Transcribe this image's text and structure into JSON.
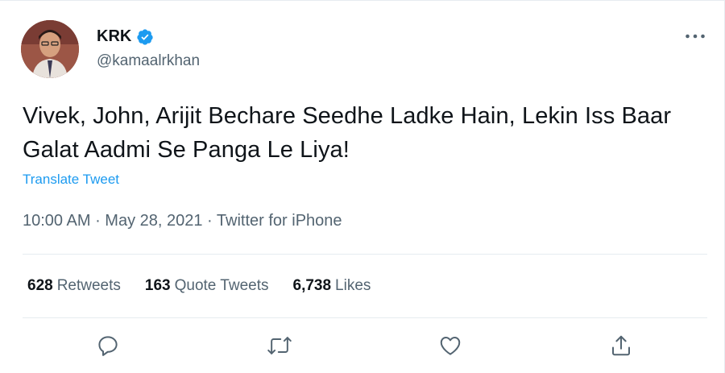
{
  "author": {
    "display_name": "KRK",
    "handle": "@kamaalrkhan",
    "verified": true,
    "avatar_icon": "profile-photo"
  },
  "tweet": {
    "text": "Vivek, John, Arijit Bechare Seedhe Ladke Hain, Lekin Iss Baar Galat Aadmi Se Panga Le Liya!",
    "translate_label": "Translate Tweet",
    "time": "10:00 AM",
    "separator": " · ",
    "date": "May 28, 2021",
    "source": "Twitter for iPhone"
  },
  "stats": {
    "retweets_count": "628",
    "retweets_label": "Retweets",
    "quote_count": "163",
    "quote_label": "Quote Tweets",
    "likes_count": "6,738",
    "likes_label": "Likes"
  },
  "actions": {
    "reply_icon": "reply-icon",
    "retweet_icon": "retweet-icon",
    "like_icon": "heart-icon",
    "share_icon": "share-icon"
  },
  "colors": {
    "accent": "#1d9bf0",
    "text": "#0f1419",
    "secondary": "#536471",
    "divider": "#e6ecf0"
  }
}
